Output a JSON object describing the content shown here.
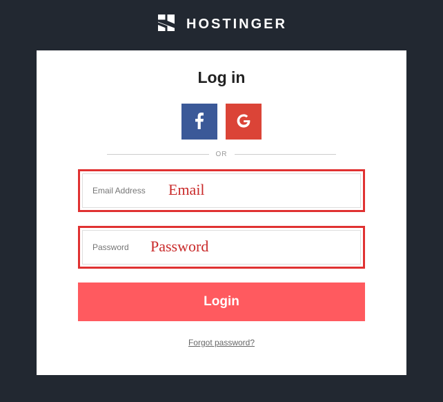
{
  "brand": {
    "name": "HOSTINGER"
  },
  "card": {
    "title": "Log in",
    "divider_text": "OR",
    "email_placeholder": "Email Address",
    "password_placeholder": "Password",
    "login_button": "Login",
    "forgot_link": "Forgot password?"
  },
  "annotations": {
    "email": "Email",
    "password": "Password"
  }
}
